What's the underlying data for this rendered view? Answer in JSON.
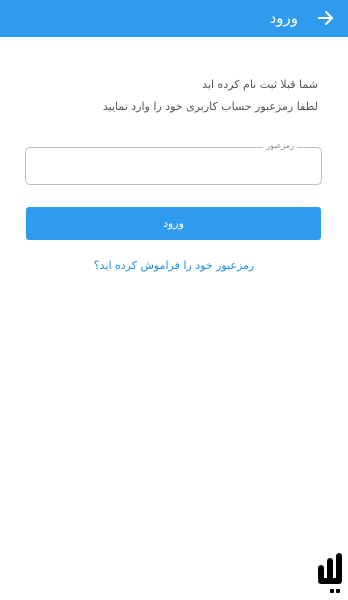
{
  "app_bar": {
    "title": "ورود",
    "back_icon": "arrow-right-icon",
    "background": "#2f9bee"
  },
  "info": {
    "line1": "شما قبلا ثبت نام کرده اید",
    "line2": "لطفا رمزعبور حساب کاربری خود را وارد نمایید"
  },
  "password_field": {
    "label": "رمزعبور",
    "value": ""
  },
  "login_button": {
    "label": "ورود",
    "background": "#2f9bee"
  },
  "forgot_link": {
    "label": "رمزعبور خود را فراموش کرده اید؟",
    "color": "#1f8fe5"
  },
  "brand": {
    "icon": "brand-logo-icon"
  }
}
